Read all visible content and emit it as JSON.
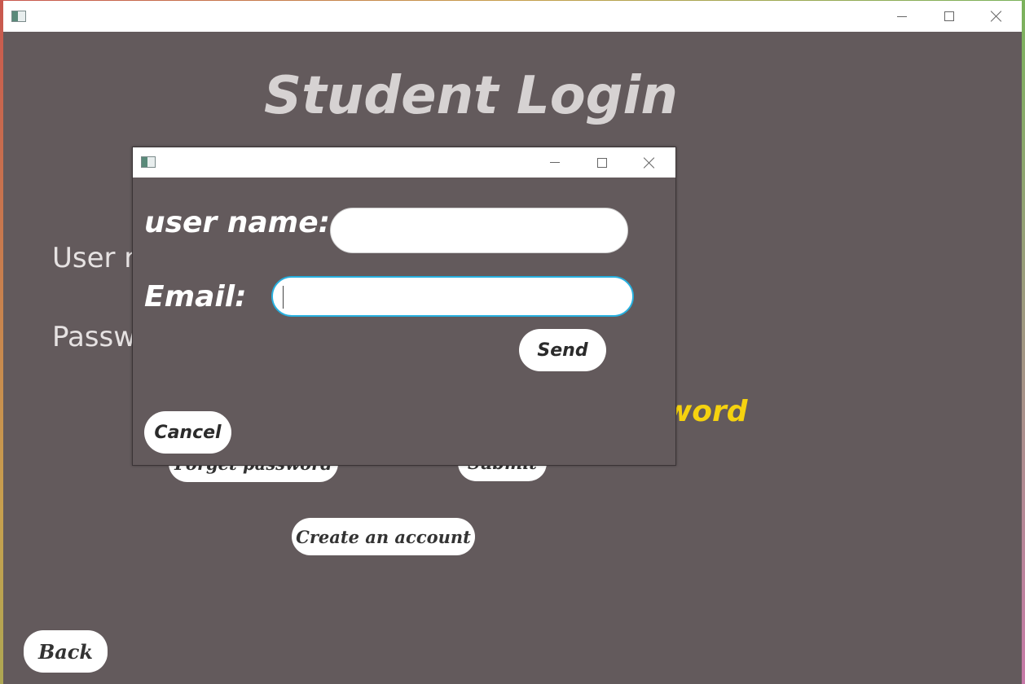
{
  "main_window": {
    "title": "Student Login",
    "user_label": "User n",
    "password_label": "Passw",
    "yellow_text": "word",
    "forget_password_button": "Forget password",
    "submit_button": "Submit",
    "create_account_button": "Create an account",
    "back_button": "Back"
  },
  "dialog": {
    "username_label": "user name:",
    "username_value": "",
    "email_label": "Email:",
    "email_value": "",
    "send_button": "Send",
    "cancel_button": "Cancel"
  },
  "colors": {
    "background": "#635a5c",
    "title": "#d6d2d2",
    "accent_yellow": "#f5d20f",
    "focus_border": "#27b0df"
  },
  "icons": [
    "app-icon",
    "minimize-icon",
    "maximize-icon",
    "close-icon"
  ]
}
